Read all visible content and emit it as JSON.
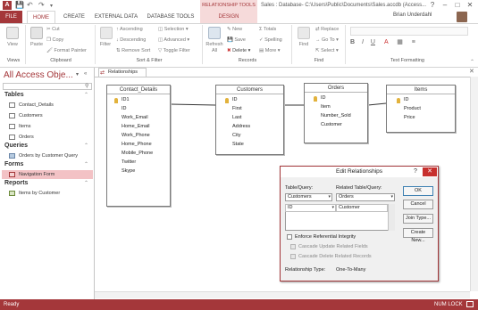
{
  "window": {
    "title": "Sales : Database- C:\\Users\\Public\\Documents\\Sales.accdb (Access...",
    "context_tab_group": "RELATIONSHIP TOOLS",
    "controls": [
      "?",
      "–",
      "□",
      "✕"
    ]
  },
  "tabs": [
    "FILE",
    "HOME",
    "CREATE",
    "EXTERNAL DATA",
    "DATABASE TOOLS",
    "DESIGN"
  ],
  "user": {
    "name": "Brian Underdahl"
  },
  "ribbon": {
    "groups": [
      "Views",
      "Clipboard",
      "Sort & Filter",
      "Records",
      "Find",
      "Text Formatting"
    ],
    "view_label": "View",
    "paste_label": "Paste",
    "cut": "Cut",
    "copy": "Copy",
    "format_painter": "Format Painter",
    "filter_label": "Filter",
    "ascending": "Ascending",
    "descending": "Descending",
    "remove_sort": "Remove Sort",
    "selection": "Selection",
    "advanced": "Advanced",
    "toggle_filter": "Toggle Filter",
    "refresh_all": "Refresh All",
    "new": "New",
    "save": "Save",
    "delete": "Delete",
    "totals": "Totals",
    "spelling": "Spelling",
    "more": "More",
    "find_label": "Find",
    "replace": "Replace",
    "goto": "Go To",
    "select": "Select"
  },
  "nav": {
    "title": "All Access Obje...",
    "sections": {
      "tables": "Tables",
      "queries": "Queries",
      "forms": "Forms",
      "reports": "Reports"
    },
    "tables": [
      "Contact_Details",
      "Customers",
      "Items",
      "Orders"
    ],
    "queries": [
      "Orders by Customer Query"
    ],
    "forms": [
      "Navigation Form"
    ],
    "reports": [
      "Items by Customer"
    ]
  },
  "doc_tab": "Relationships",
  "tables": {
    "contact_details": {
      "title": "Contact_Details",
      "fields": [
        "ID1",
        "ID",
        "Work_Email",
        "Home_Email",
        "Work_Phone",
        "Home_Phone",
        "Mobile_Phone",
        "Twitter",
        "Skype"
      ]
    },
    "customers": {
      "title": "Customers",
      "fields": [
        "ID",
        "First",
        "Last",
        "Address",
        "City",
        "State"
      ]
    },
    "orders": {
      "title": "Orders",
      "fields": [
        "ID",
        "Item",
        "Number_Sold",
        "Customer"
      ]
    },
    "items": {
      "title": "Items",
      "fields": [
        "ID",
        "Product",
        "Price"
      ]
    }
  },
  "dialog": {
    "title": "Edit Relationships",
    "help": "?",
    "table_query_label": "Table/Query:",
    "related_label": "Related Table/Query:",
    "table_value": "Customers",
    "related_value": "Orders",
    "field_left": "ID",
    "field_right": "Customer",
    "enforce": "Enforce Referential Integrity",
    "cascade_update": "Cascade Update Related Fields",
    "cascade_delete": "Cascade Delete Related Records",
    "rel_type_label": "Relationship Type:",
    "rel_type_value": "One-To-Many",
    "buttons": {
      "ok": "OK",
      "cancel": "Cancel",
      "join_type": "Join Type...",
      "create_new": "Create New..."
    }
  },
  "status": {
    "left": "Ready",
    "right": "NUM LOCK"
  },
  "colors": {
    "accent": "#a4373a",
    "context": "#f6dada"
  }
}
